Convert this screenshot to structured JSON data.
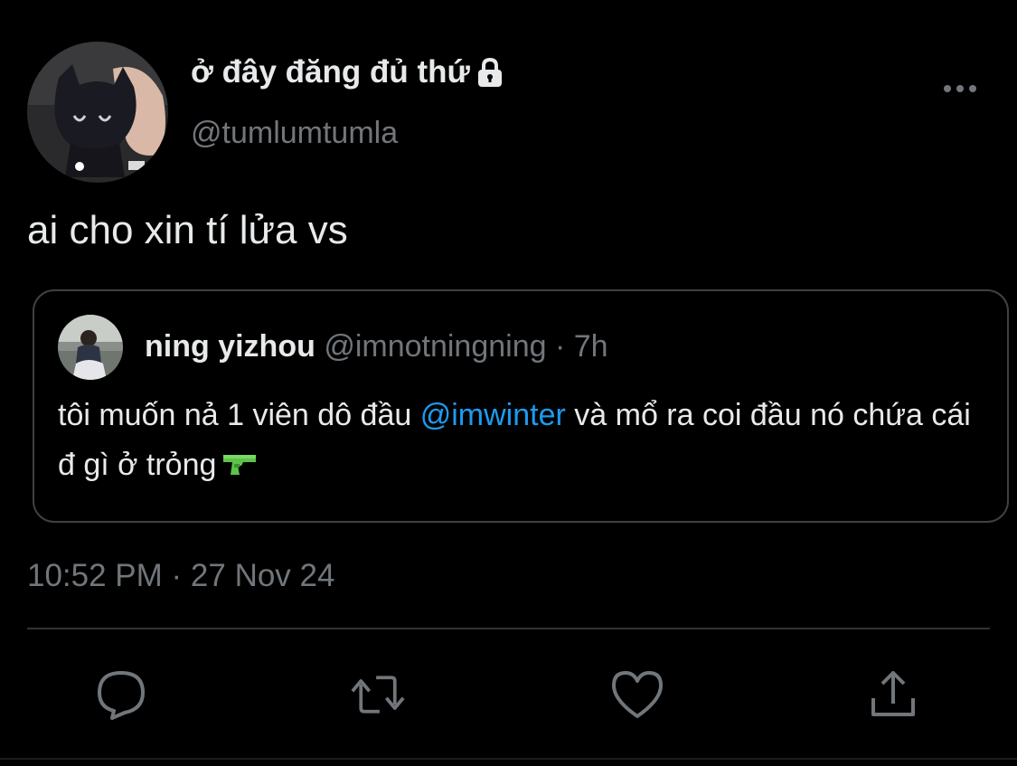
{
  "author": {
    "display_name": "ở đây đăng đủ thứ",
    "handle": "@tumlumtumla",
    "avatar_icon": "black-cat-plush-avatar",
    "protected_icon": "lock-icon"
  },
  "tweet": {
    "text": "ai cho xin tí lửa vs",
    "timestamp": "10:52 PM · 27 Nov 24"
  },
  "quoted_tweet": {
    "display_name": "ning yizhou",
    "handle": "@imnotningning",
    "separator": "·",
    "time": "7h",
    "text_part1": "tôi muốn nả 1 viên dô đầu ",
    "mention": "@imwinter",
    "text_part2": " và mổ ra coi đầu nó chứa cái đ gì ở trỏng",
    "emoji_icon": "water-pistol-emoji"
  },
  "actions": {
    "reply_icon": "reply-icon",
    "retweet_icon": "retweet-icon",
    "like_icon": "heart-icon",
    "share_icon": "share-icon"
  },
  "colors": {
    "background": "#000000",
    "primary_text": "#e7e9ea",
    "secondary_text": "#71767b",
    "mention": "#1d9bf0",
    "border": "#3e4144"
  }
}
